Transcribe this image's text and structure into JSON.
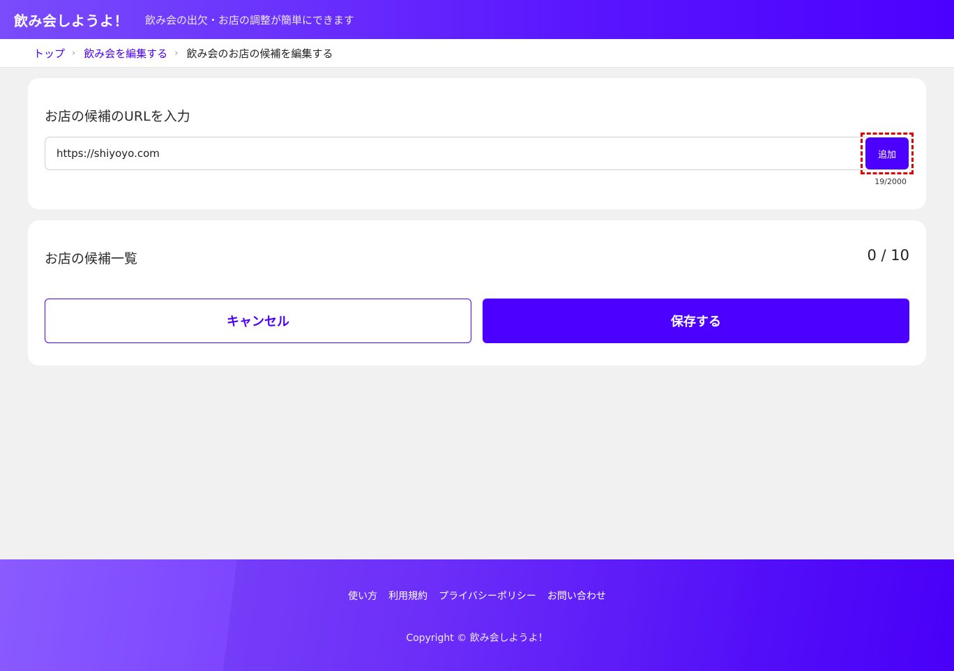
{
  "header": {
    "title": "飲み会しようよ！",
    "tagline": "飲み会の出欠・お店の調整が簡単にできます"
  },
  "breadcrumb": {
    "items": [
      "トップ",
      "飲み会を編集する",
      "飲み会のお店の候補を編集する"
    ],
    "separator": "›"
  },
  "url_section": {
    "title": "お店の候補のURLを入力",
    "input_value": "https://shiyoyo.com",
    "add_label": "追加",
    "char_count": "19/2000"
  },
  "list_section": {
    "title": "お店の候補一覧",
    "count": "0 / 10",
    "cancel_label": "キャンセル",
    "save_label": "保存する"
  },
  "footer": {
    "links": [
      "使い方",
      "利用規約",
      "プライバシーポリシー",
      "お問い合わせ"
    ],
    "copyright": "Copyright © 飲み会しようよ！"
  },
  "colors": {
    "accent": "#4c00ff",
    "highlight": "#e00000"
  }
}
